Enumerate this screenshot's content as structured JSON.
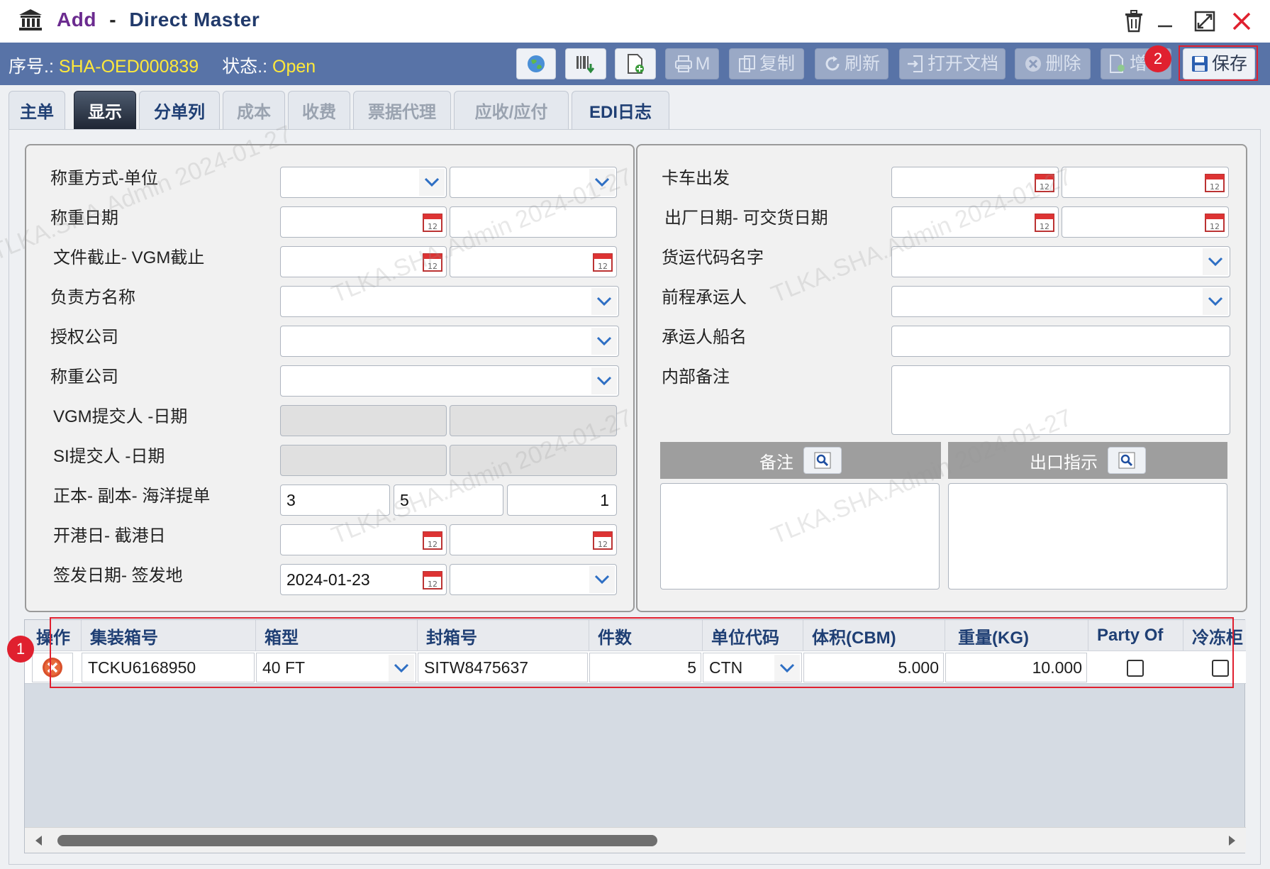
{
  "window": {
    "title_action": "Add",
    "title_sep": "-",
    "title_main": "Direct Master"
  },
  "toolbar": {
    "seq_label": "序号.:",
    "seq_value": "SHA-OED000839",
    "status_label": "状态.:",
    "status_value": "Open",
    "print_label": "M",
    "copy_label": "复制",
    "refresh_label": "刷新",
    "open_doc_label": "打开文档",
    "delete_label": "删除",
    "add_label": "增",
    "save_label": "保存"
  },
  "tabs": [
    {
      "label": "主单"
    },
    {
      "label": "显示"
    },
    {
      "label": "分单列"
    },
    {
      "label": "成本"
    },
    {
      "label": "收费"
    },
    {
      "label": "票据代理"
    },
    {
      "label": "应收/应付"
    },
    {
      "label": "EDI日志"
    }
  ],
  "left_form": {
    "weigh_method_label": "称重方式-单位",
    "weigh_date_label": "称重日期",
    "doc_cutoff_label": "文件截止- VGM截止",
    "responsible_label": "负责方名称",
    "auth_company_label": "授权公司",
    "weigh_company_label": "称重公司",
    "vgm_submitter_label": "VGM提交人 -日期",
    "si_submitter_label": "SI提交人 -日期",
    "bl_copies_label": "正本- 副本- 海洋提单",
    "original_count": "3",
    "copy_count": "5",
    "ocean_bl_count": "1",
    "port_dates_label": "开港日- 截港日",
    "issue_label": "签发日期- 签发地",
    "issue_date": "2024-01-23"
  },
  "right_form": {
    "truck_depart_label": "卡车出发",
    "factory_date_label": "出厂日期- 可交货日期",
    "forwarder_code_label": "货运代码名字",
    "pre_carrier_label": "前程承运人",
    "vessel_label": "承运人船名",
    "internal_remark_label": "内部备注",
    "remark_header": "备注",
    "export_instr_header": "出口指示"
  },
  "grid": {
    "columns": [
      "操作",
      "集装箱号",
      "箱型",
      "封箱号",
      "件数",
      "单位代码",
      "体积(CBM)",
      "重量(KG)",
      "Party Of",
      "冷冻柜"
    ],
    "rows": [
      {
        "container_no": "TCKU6168950",
        "box_type": "40 FT",
        "seal_no": "SITW8475637",
        "pieces": "5",
        "unit_code": "CTN",
        "volume": "5.000",
        "weight": "10.000",
        "party_of": false,
        "reefer": false
      }
    ]
  },
  "annotations": {
    "badge1": "1",
    "badge2": "2",
    "accent_color": "#e0202f"
  },
  "watermark": "TLKA.SHA.Admin 2024-01-27"
}
